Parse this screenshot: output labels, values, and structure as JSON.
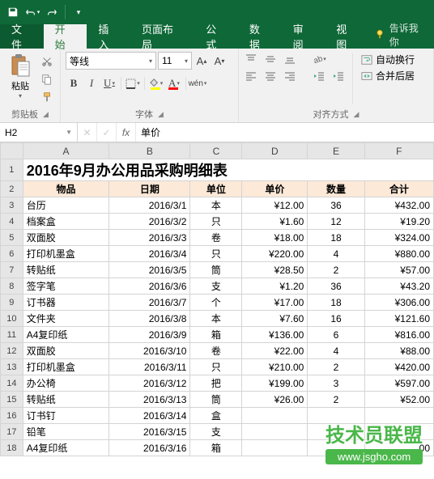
{
  "tabs": {
    "file": "文件",
    "home": "开始",
    "insert": "插入",
    "layout": "页面布局",
    "formulas": "公式",
    "data": "数据",
    "review": "审阅",
    "view": "视图",
    "tell": "告诉我你"
  },
  "ribbon": {
    "clipboard": {
      "paste": "粘贴",
      "label": "剪贴板"
    },
    "font": {
      "name": "等线",
      "size": "11",
      "wen": "wén",
      "label": "字体"
    },
    "align": {
      "wrap": "自动换行",
      "merge": "合并后居",
      "label": "对齐方式"
    }
  },
  "namebox": "H2",
  "formula": "单价",
  "cols": [
    "A",
    "B",
    "C",
    "D",
    "E",
    "F"
  ],
  "title": "2016年9月办公用品采购明细表",
  "headers": [
    "物品",
    "日期",
    "单位",
    "单价",
    "数量",
    "合计"
  ],
  "rows": [
    {
      "n": 3,
      "a": "台历",
      "b": "2016/3/1",
      "c": "本",
      "d": "¥12.00",
      "e": "36",
      "f": "¥432.00"
    },
    {
      "n": 4,
      "a": "档案盒",
      "b": "2016/3/2",
      "c": "只",
      "d": "¥1.60",
      "e": "12",
      "f": "¥19.20"
    },
    {
      "n": 5,
      "a": "双面胶",
      "b": "2016/3/3",
      "c": "卷",
      "d": "¥18.00",
      "e": "18",
      "f": "¥324.00"
    },
    {
      "n": 6,
      "a": "打印机墨盒",
      "b": "2016/3/4",
      "c": "只",
      "d": "¥220.00",
      "e": "4",
      "f": "¥880.00"
    },
    {
      "n": 7,
      "a": "转贴纸",
      "b": "2016/3/5",
      "c": "筒",
      "d": "¥28.50",
      "e": "2",
      "f": "¥57.00"
    },
    {
      "n": 8,
      "a": "签字笔",
      "b": "2016/3/6",
      "c": "支",
      "d": "¥1.20",
      "e": "36",
      "f": "¥43.20"
    },
    {
      "n": 9,
      "a": "订书器",
      "b": "2016/3/7",
      "c": "个",
      "d": "¥17.00",
      "e": "18",
      "f": "¥306.00"
    },
    {
      "n": 10,
      "a": "文件夹",
      "b": "2016/3/8",
      "c": "本",
      "d": "¥7.60",
      "e": "16",
      "f": "¥121.60"
    },
    {
      "n": 11,
      "a": "A4复印纸",
      "b": "2016/3/9",
      "c": "箱",
      "d": "¥136.00",
      "e": "6",
      "f": "¥816.00"
    },
    {
      "n": 12,
      "a": "双面胶",
      "b": "2016/3/10",
      "c": "卷",
      "d": "¥22.00",
      "e": "4",
      "f": "¥88.00"
    },
    {
      "n": 13,
      "a": "打印机墨盒",
      "b": "2016/3/11",
      "c": "只",
      "d": "¥210.00",
      "e": "2",
      "f": "¥420.00"
    },
    {
      "n": 14,
      "a": "办公椅",
      "b": "2016/3/12",
      "c": "把",
      "d": "¥199.00",
      "e": "3",
      "f": "¥597.00"
    },
    {
      "n": 15,
      "a": "转贴纸",
      "b": "2016/3/13",
      "c": "筒",
      "d": "¥26.00",
      "e": "2",
      "f": "¥52.00"
    },
    {
      "n": 16,
      "a": "订书钉",
      "b": "2016/3/14",
      "c": "盒",
      "d": "",
      "e": "",
      "f": ""
    },
    {
      "n": 17,
      "a": "铅笔",
      "b": "2016/3/15",
      "c": "支",
      "d": "",
      "e": "",
      "f": ""
    },
    {
      "n": 18,
      "a": "A4复印纸",
      "b": "2016/3/16",
      "c": "箱",
      "d": "",
      "e": "",
      "f": ".00"
    }
  ],
  "watermark": {
    "top": "技术员联盟",
    "bottom": "www.jsgho.com"
  }
}
